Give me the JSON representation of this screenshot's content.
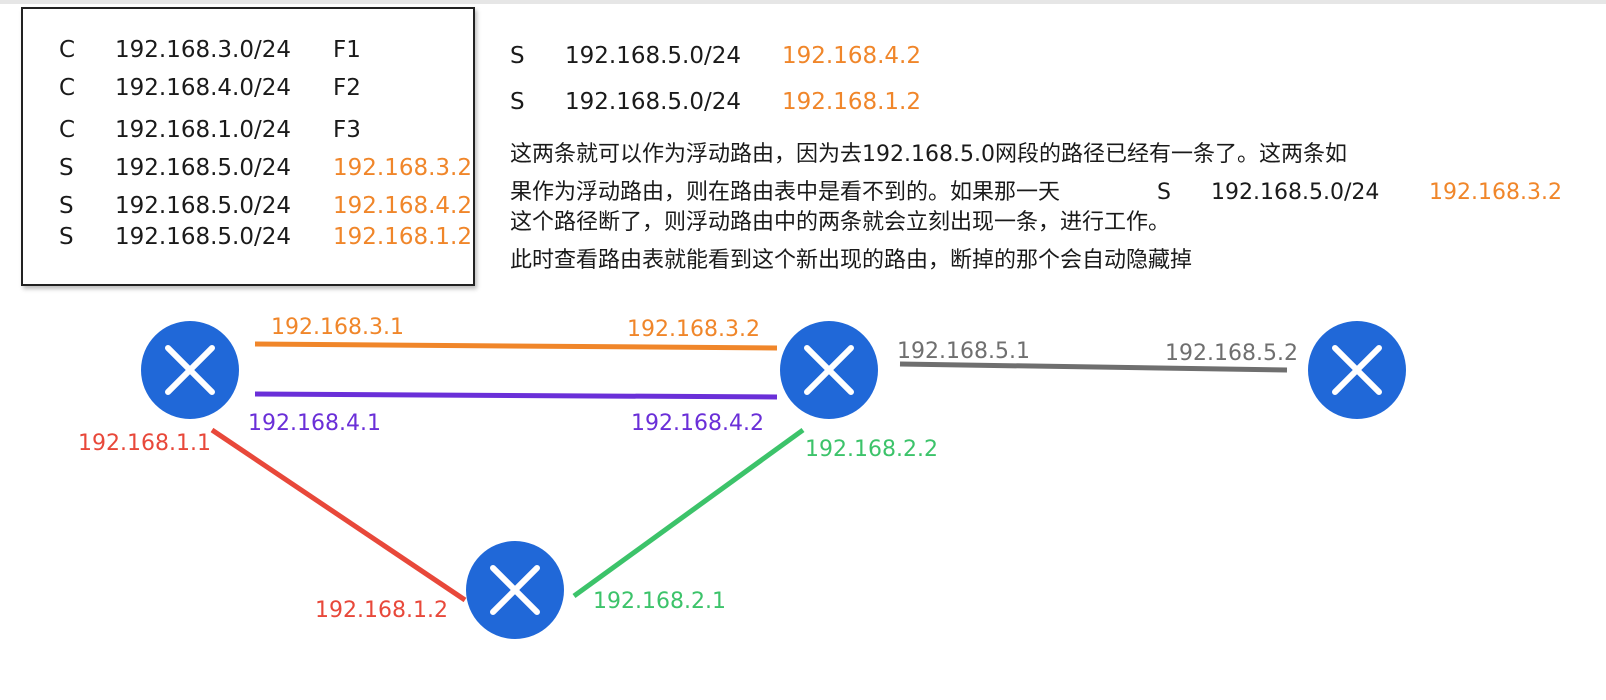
{
  "routing_table": [
    {
      "type": "C",
      "network": "192.168.3.0/24",
      "next": "F1",
      "next_color": "#1a1a1a"
    },
    {
      "type": "C",
      "network": "192.168.4.0/24",
      "next": "F2",
      "next_color": "#1a1a1a"
    },
    {
      "type": "C",
      "network": "192.168.1.0/24",
      "next": "F3",
      "next_color": "#1a1a1a"
    },
    {
      "type": "S",
      "network": "192.168.5.0/24",
      "next": "192.168.3.2",
      "next_color": "#f0862a"
    },
    {
      "type": "S",
      "network": "192.168.5.0/24",
      "next": "192.168.4.2",
      "next_color": "#f0862a"
    },
    {
      "type": "S",
      "network": "192.168.5.0/24",
      "next": "192.168.1.2",
      "next_color": "#f0862a"
    }
  ],
  "floating_routes": [
    {
      "type": "S",
      "network": "192.168.5.0/24",
      "next": "192.168.4.2"
    },
    {
      "type": "S",
      "network": "192.168.5.0/24",
      "next": "192.168.1.2"
    }
  ],
  "explanation": {
    "line1": "这两条就可以作为浮动路由，因为去192.168.5.0网段的路径已经有一条了。这两条如",
    "line2": "果作为浮动路由，则在路由表中是看不到的。如果那一天",
    "inline_type": "S",
    "inline_network": "192.168.5.0/24",
    "inline_next": "192.168.3.2",
    "line3": "这个路径断了，则浮动路由中的两条就会立刻出现一条，进行工作。",
    "line4": "此时查看路由表就能看到这个新出现的路由，断掉的那个会自动隐藏掉"
  },
  "links": {
    "orange": {
      "left": "192.168.3.1",
      "right": "192.168.3.2",
      "color": "#f0862a"
    },
    "purple": {
      "left": "192.168.4.1",
      "right": "192.168.4.2",
      "color": "#6a2fd8"
    },
    "gray": {
      "left": "192.168.5.1",
      "right": "192.168.5.2",
      "color": "#6f6f6f"
    },
    "red": {
      "top": "192.168.1.1",
      "bottom": "192.168.1.2",
      "color": "#e8483a"
    },
    "green": {
      "top": "192.168.2.2",
      "bottom": "192.168.2.1",
      "color": "#3cc36a"
    }
  },
  "routers": [
    {
      "name": "router-a",
      "icon": "router-x-icon"
    },
    {
      "name": "router-b",
      "icon": "router-x-icon"
    },
    {
      "name": "router-c",
      "icon": "router-x-icon"
    },
    {
      "name": "router-d",
      "icon": "router-x-icon"
    }
  ],
  "router_color": "#2068d8"
}
